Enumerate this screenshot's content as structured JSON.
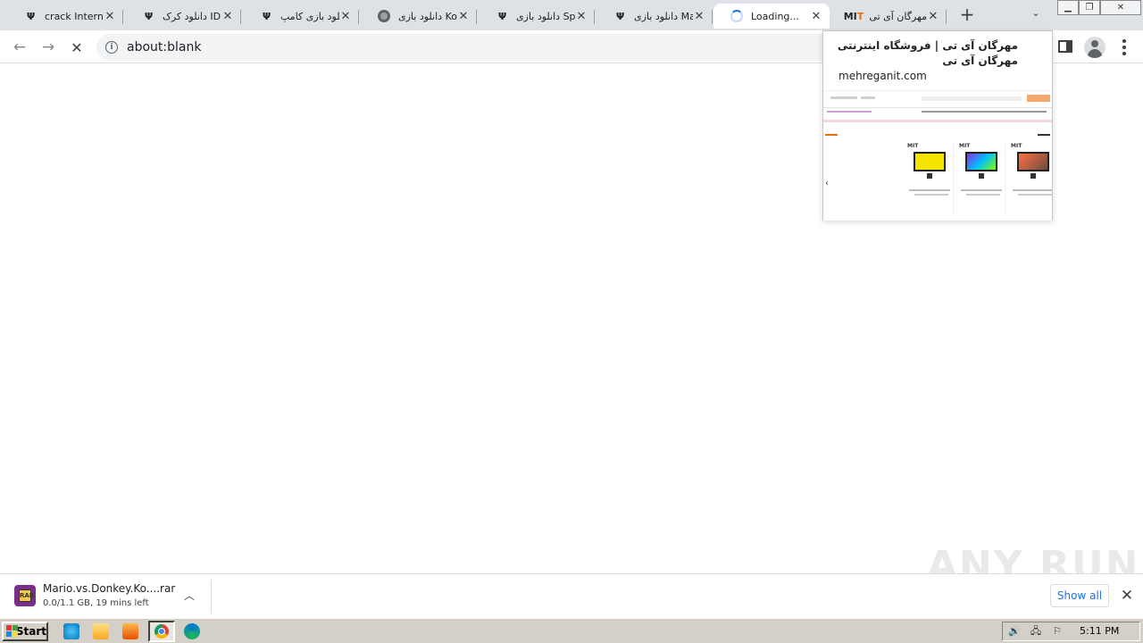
{
  "tabs": [
    {
      "favicon": "psi-logo-icon",
      "title": "crack Internet",
      "active": false
    },
    {
      "favicon": "psi-logo-icon",
      "title": "دانلود کرک IDM",
      "active": false
    },
    {
      "favicon": "psi-logo-icon",
      "title": "دانلود بازی کامپ",
      "active": false
    },
    {
      "favicon": "globe-icon",
      "title": "دانلود بازی Kong",
      "active": false
    },
    {
      "favicon": "psi-logo-icon",
      "title": "دانلود بازی Space",
      "active": false
    },
    {
      "favicon": "psi-logo-icon",
      "title": "دانلود بازی Mario",
      "active": false
    },
    {
      "favicon": "loading-spinner-icon",
      "title": "Loading...",
      "active": true
    },
    {
      "favicon": "mit-logo-icon",
      "title": "مهرگان آی تی",
      "active": false
    }
  ],
  "mit_logo": {
    "m": "M",
    "i": "I",
    "t": "T"
  },
  "omnibox": {
    "url": "about:blank"
  },
  "hovercard": {
    "title": "مهرگان آی تی | فروشگاه اینترنتی مهرگان آی تی",
    "domain": "mehreganit.com"
  },
  "download": {
    "filename": "Mario.vs.Donkey.Ko....rar",
    "status": "0.0/1.1 GB, 19 mins left",
    "show_all": "Show all"
  },
  "watermark": "ANY RUN",
  "taskbar": {
    "start_label": "Start",
    "clock": "5:11 PM"
  },
  "colors": {
    "tabstrip": "#dee1e6",
    "accent_blue": "#1a73e8",
    "taskbar": "#d4d0c8"
  }
}
